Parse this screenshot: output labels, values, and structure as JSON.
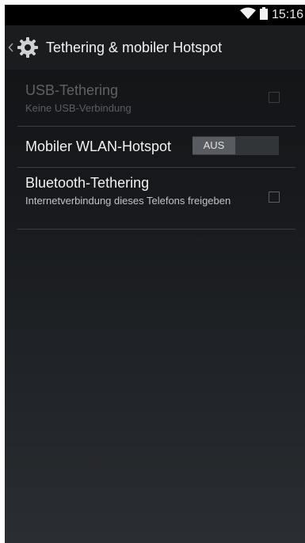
{
  "status_bar": {
    "time": "15:16"
  },
  "action_bar": {
    "title": "Tethering & mobiler Hotspot",
    "up_icon": "chevron-left-icon",
    "app_icon": "gear-icon"
  },
  "settings": [
    {
      "title": "USB-Tethering",
      "summary": "Keine USB-Verbindung",
      "control": "checkbox",
      "checked": false,
      "enabled": false
    },
    {
      "title": "Mobiler WLAN-Hotspot",
      "control": "switch",
      "switch_label": "AUS",
      "on": false,
      "enabled": true
    },
    {
      "title": "Bluetooth-Tethering",
      "summary": "Internetverbindung dieses Telefons freigeben",
      "control": "checkbox",
      "checked": false,
      "enabled": true
    }
  ],
  "colors": {
    "background": "#16181b",
    "action_bar": "#1b1c1e",
    "divider": "#3b3e42",
    "primary_text": "#f2f2f2",
    "disabled_text": "#5f6265"
  }
}
